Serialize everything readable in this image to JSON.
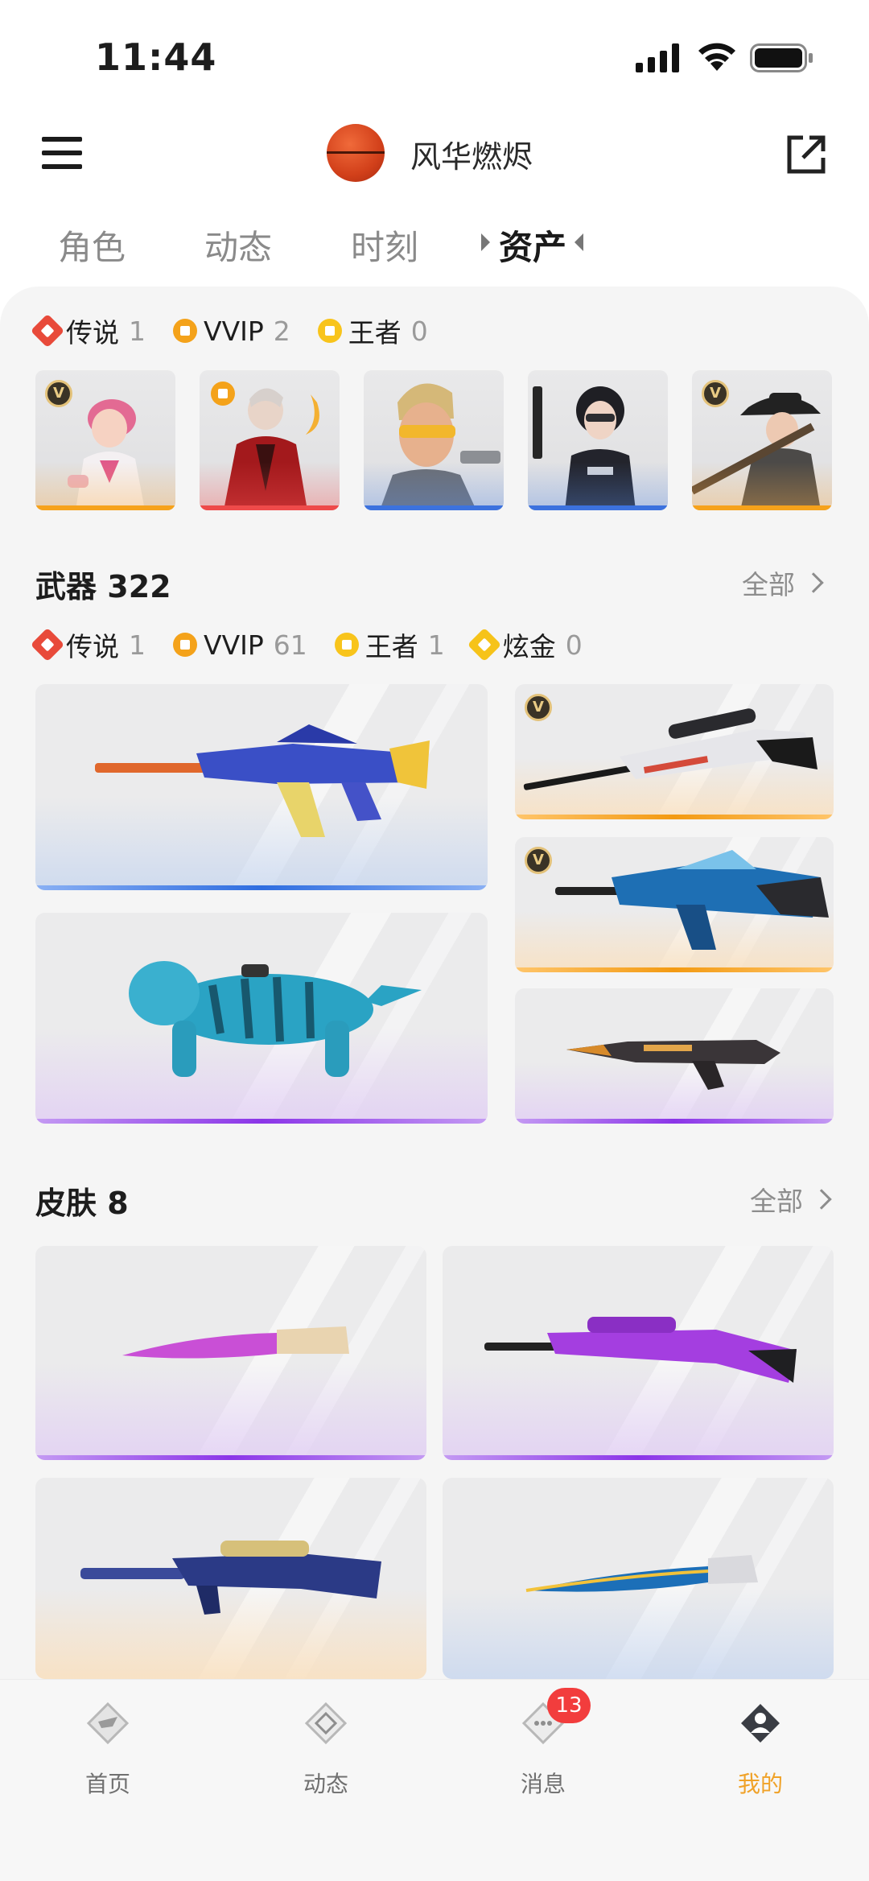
{
  "status_bar": {
    "time": "11:44"
  },
  "header": {
    "username": "风华燃烬"
  },
  "tabs": [
    {
      "label": "角色"
    },
    {
      "label": "动态"
    },
    {
      "label": "时刻"
    },
    {
      "label": "资产"
    }
  ],
  "characters": {
    "rarity": [
      {
        "label": "传说",
        "count": "1",
        "icon": "legend-badge-icon"
      },
      {
        "label": "VVIP",
        "count": "2",
        "icon": "vvip-badge-icon"
      },
      {
        "label": "王者",
        "count": "0",
        "icon": "king-badge-icon"
      }
    ],
    "cards": [
      {
        "name": "character-pink-girl",
        "tier": "orange",
        "vbadge": "V"
      },
      {
        "name": "character-fire-mage",
        "tier": "red",
        "vbadge": ""
      },
      {
        "name": "character-sunglasses",
        "tier": "blue",
        "vbadge": ""
      },
      {
        "name": "character-swat-girl",
        "tier": "blue",
        "vbadge": ""
      },
      {
        "name": "character-cowgirl",
        "tier": "orange",
        "vbadge": "V"
      }
    ]
  },
  "weapons": {
    "title": "武器",
    "count": "322",
    "see_all": "全部",
    "rarity": [
      {
        "label": "传说",
        "count": "1",
        "icon": "legend-badge-icon"
      },
      {
        "label": "VVIP",
        "count": "61",
        "icon": "vvip-badge-icon"
      },
      {
        "label": "王者",
        "count": "1",
        "icon": "king-badge-icon"
      },
      {
        "label": "炫金",
        "count": "0",
        "icon": "gold-badge-icon"
      }
    ]
  },
  "skins": {
    "title": "皮肤",
    "count": "8",
    "see_all": "全部"
  },
  "bottom_nav": [
    {
      "label": "首页",
      "icon": "home-icon"
    },
    {
      "label": "动态",
      "icon": "feed-icon"
    },
    {
      "label": "消息",
      "icon": "message-icon",
      "badge": "13"
    },
    {
      "label": "我的",
      "icon": "profile-icon",
      "active": true
    }
  ],
  "colors": {
    "accent": "#f0a228",
    "legend": "#e84a3a",
    "vvip": "#f4a21a",
    "king": "#f8c41b",
    "gold": "#f6c319",
    "badge": "#f23d3d"
  }
}
